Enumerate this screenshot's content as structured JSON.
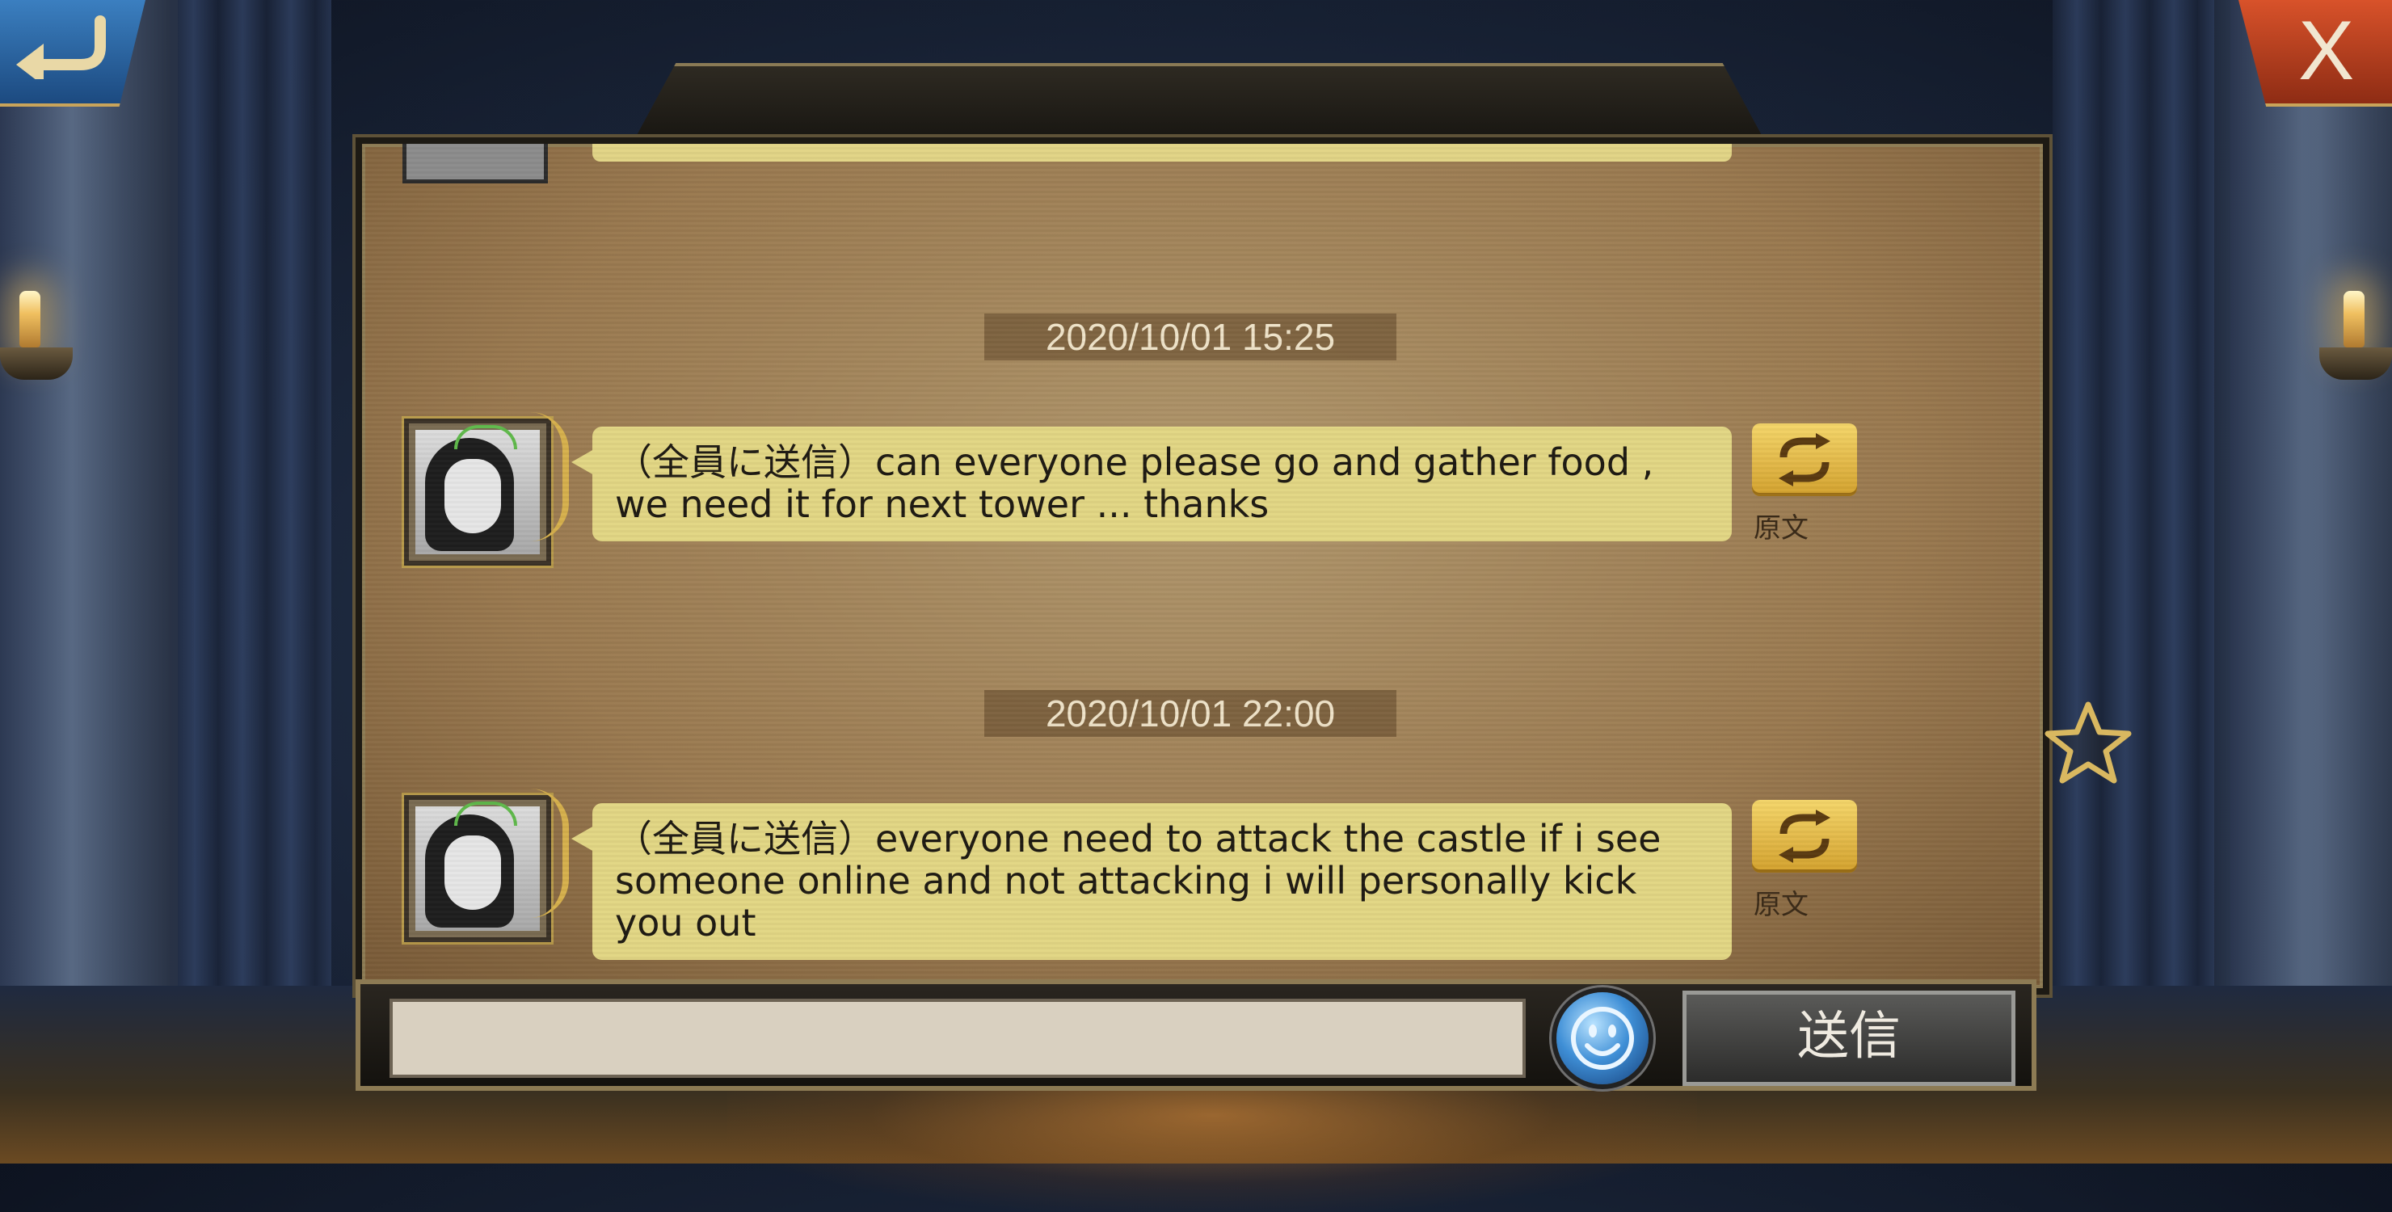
{
  "header": {
    "title": "",
    "back_icon": "back-arrow-icon",
    "close_label": "X"
  },
  "messages": [
    {
      "timestamp": "2020/10/01 15:25",
      "text": "（全員に送信）can everyone please go and gather food , we need it for next tower ... thanks",
      "translate_label": "原文",
      "translate_icon": "refresh-icon"
    },
    {
      "timestamp": "2020/10/01 22:00",
      "text": "（全員に送信）everyone need to attack the castle if i see someone online and not attacking i will personally kick you out",
      "translate_label": "原文",
      "translate_icon": "refresh-icon"
    }
  ],
  "composer": {
    "input_value": "",
    "placeholder": "",
    "emoji_icon": "smiley-icon",
    "send_label": "送信"
  },
  "side": {
    "favorite_icon": "star-icon"
  },
  "colors": {
    "bubble": "#e2d684",
    "parchment": "#a8865a",
    "translate_button": "#e5b845",
    "back_button": "#2a64a6",
    "close_button": "#c0401f"
  }
}
